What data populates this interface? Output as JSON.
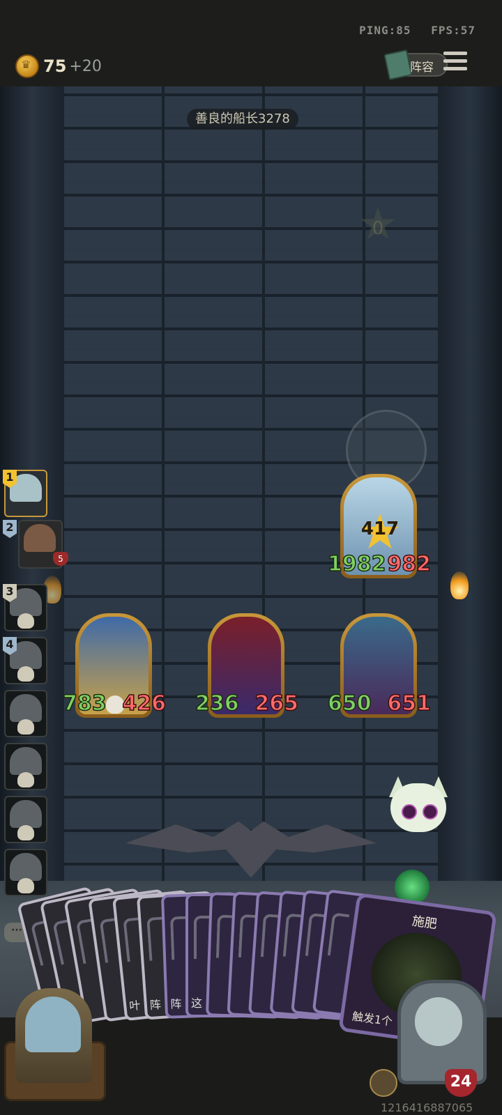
{
  "hud": {
    "ping": "PING:85",
    "fps": "FPS:57",
    "gold": "75",
    "gold_income": "+20",
    "lineup_label": "阵容"
  },
  "board": {
    "opponent_name": "善良的船长3278",
    "star_counter": "0",
    "enemy_minions": [
      {
        "attack": "1982",
        "health": "982",
        "star_value": "417"
      }
    ],
    "my_minions": [
      {
        "attack": "783",
        "health": "426"
      },
      {
        "attack": "236",
        "health": "265"
      },
      {
        "attack": "650",
        "health": "651"
      }
    ]
  },
  "roster": [
    {
      "rank": "1",
      "active": true
    },
    {
      "rank": "2",
      "hearts": "5"
    },
    {
      "rank": "3"
    },
    {
      "rank": "4"
    },
    {
      "rank": ""
    },
    {
      "rank": ""
    },
    {
      "rank": ""
    },
    {
      "rank": ""
    }
  ],
  "hand": {
    "small_labels": [
      "",
      "",
      "",
      "",
      "叶",
      "阵",
      "阵",
      "这",
      "",
      "",
      "",
      "",
      "",
      ""
    ],
    "featured_card": {
      "title": "施肥",
      "description": "触发1个"
    }
  },
  "bottom": {
    "chat_label": "···",
    "opponent_health": "24",
    "uid": "1216416887065"
  },
  "colors": {
    "attack": "#7fd163",
    "health": "#ff6b6b",
    "frame_gold": "#c9983a"
  }
}
